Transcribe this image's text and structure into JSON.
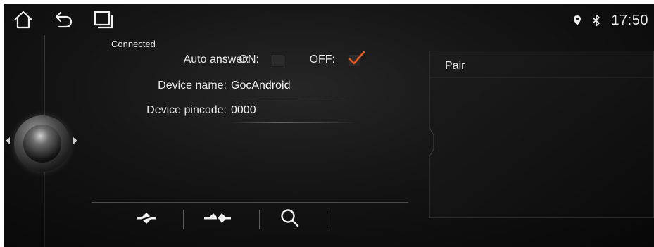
{
  "status_bar": {
    "time": "17:50",
    "icons": [
      "location-pin-icon",
      "bluetooth-icon"
    ]
  },
  "nav": {
    "icons": [
      "home-icon",
      "back-icon",
      "windows-icon"
    ]
  },
  "bluetooth_settings": {
    "connection_status": "Connected",
    "auto_answer": {
      "label": "Auto answer:",
      "on_label": "ON:",
      "off_label": "OFF:",
      "selected": "OFF"
    },
    "device_name": {
      "label": "Device name:",
      "value": "GocAndroid"
    },
    "device_pincode": {
      "label": "Device pincode:",
      "value": "0000"
    }
  },
  "pair_panel": {
    "title": "Pair"
  },
  "toolbar": {
    "icons": [
      "connect-icon",
      "disconnect-icon",
      "search-icon"
    ]
  },
  "colors": {
    "accent": "#e8571e",
    "text": "#e8e8e8",
    "background": "#111111"
  }
}
